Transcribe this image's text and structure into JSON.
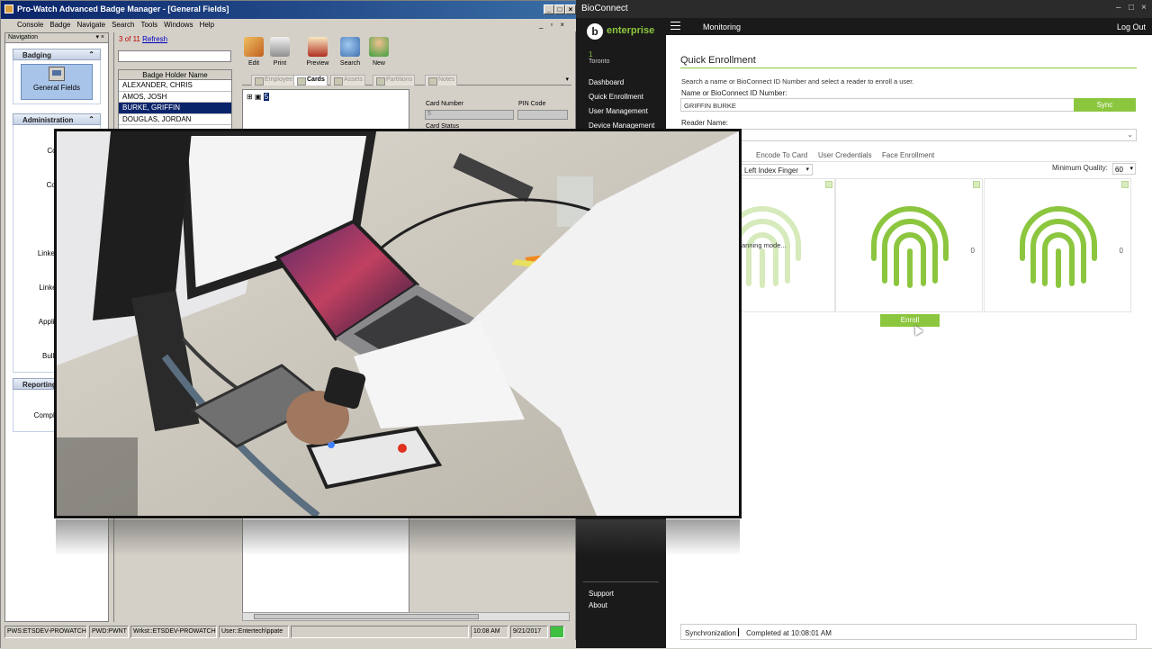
{
  "prowatch": {
    "title": "Pro-Watch Advanced Badge Manager - [General Fields]",
    "menu": [
      "Console",
      "Badge",
      "Navigate",
      "Search",
      "Tools",
      "Windows",
      "Help"
    ],
    "nav": {
      "header": "Navigation",
      "sections": {
        "badging": "Badging",
        "administration": "Administration",
        "reporting": "Reporting"
      },
      "general_fields": "General Fields",
      "admin_items": [
        "Con",
        "Comp",
        "A",
        "Linked B",
        "Linked",
        "Applicati",
        "Bullet"
      ],
      "reporting_items": [
        "Complia"
      ]
    },
    "list": {
      "count": "3 of 11",
      "refresh": "Refresh",
      "column": "Badge Holder Name",
      "rows": [
        "ALEXANDER, CHRIS",
        "AMOS, JOSH",
        "BURKE, GRIFFIN",
        "DOUGLAS, JORDAN"
      ],
      "selected_index": 2
    },
    "toolbar": [
      "Edit",
      "Print",
      "Preview",
      "Search",
      "New"
    ],
    "tabs": [
      "Employee",
      "Cards",
      "Assets",
      "Partitions",
      "Notes"
    ],
    "tree_node": "5",
    "card": {
      "number_label": "Card Number",
      "pin_label": "PIN Code",
      "number_value": "5",
      "status_label": "Card Status"
    },
    "status": [
      "PWS:ETSDEV-PROWATCH",
      "PWD:PWNT",
      "Wrkst::ETSDEV-PROWATCH",
      "User::Entertech\\ppate",
      "",
      "10:08 AM",
      "9/21/2017"
    ]
  },
  "bioconnect": {
    "title": "BioConnect",
    "logo_text": "enterprise",
    "site_number": "1",
    "site_name": "Toronto",
    "nav": [
      "Dashboard",
      "Quick Enrollment",
      "User Management",
      "Device Management"
    ],
    "nav_bottom": [
      "Support",
      "About"
    ],
    "topbar": {
      "section": "Monitoring",
      "logout": "Log Out"
    },
    "page_title": "Quick Enrollment",
    "description": "Search a name or BioConnect ID Number and select a reader to enroll a user.",
    "name_label": "Name or BioConnect ID Number:",
    "name_value": "GRIFFIN BURKE",
    "sync_button": "Sync",
    "reader_label": "Reader Name:",
    "tabs": [
      "t",
      "Encode To Card",
      "User Credentials",
      "Face Enrollment"
    ],
    "finger": "Left Index Finger",
    "min_quality_label": "Minimum Quality:",
    "min_quality_value": "60",
    "scanning_text": "anning mode...",
    "scan_counts": [
      "0",
      "0"
    ],
    "enroll_button": "Enroll",
    "sync_status_label": "Synchronization",
    "sync_status_value": "Completed at 10:08:01 AM"
  },
  "colors": {
    "accent_green": "#8cc63f",
    "dark_sidebar": "#1a1a1a",
    "win_title_blue": "#0a246a"
  }
}
